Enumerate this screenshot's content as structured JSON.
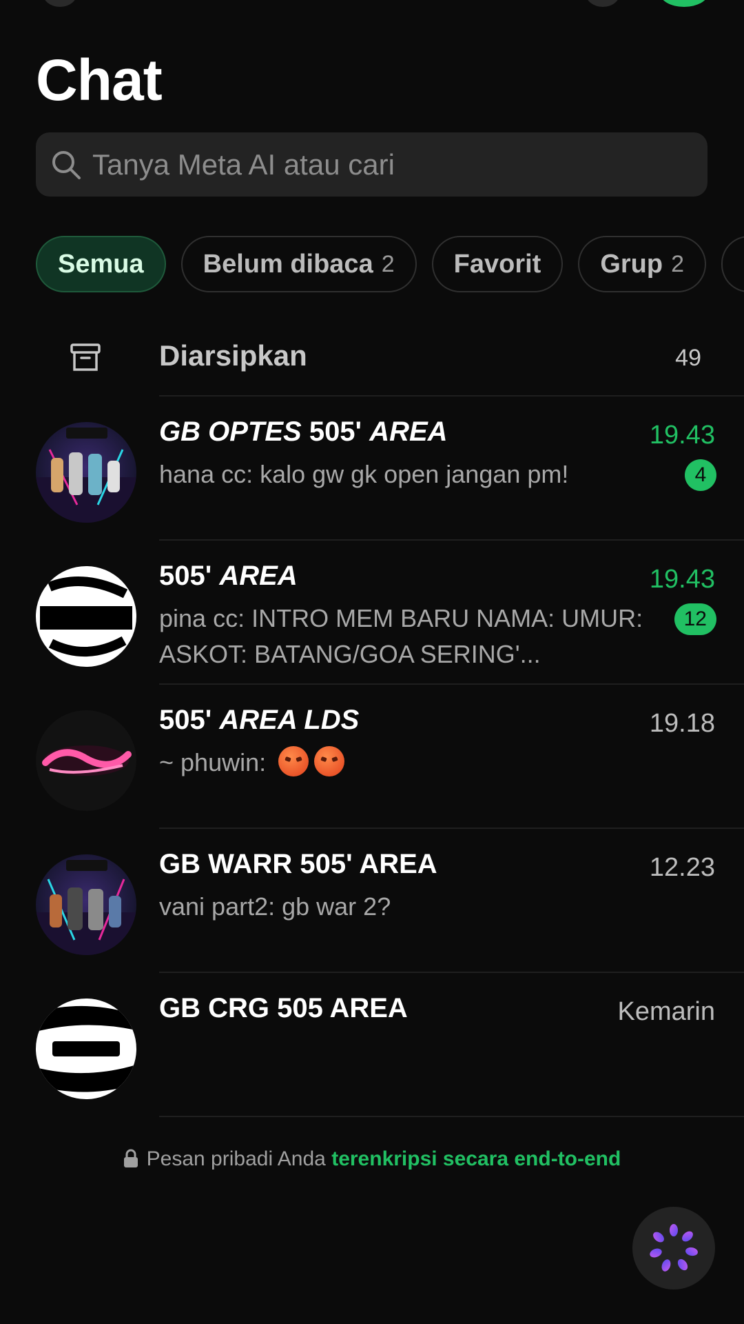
{
  "header": {
    "title": "Chat"
  },
  "search": {
    "placeholder": "Tanya Meta AI atau cari"
  },
  "filters": [
    {
      "label": "Semua",
      "count": "",
      "active": true
    },
    {
      "label": "Belum dibaca",
      "count": "2",
      "active": false
    },
    {
      "label": "Favorit",
      "count": "",
      "active": false
    },
    {
      "label": "Grup",
      "count": "2",
      "active": false
    }
  ],
  "archived": {
    "label": "Diarsipkan",
    "count": "49"
  },
  "chats": [
    {
      "name_italic": "GB OPTES",
      "name_normal": " 505' ",
      "name_italic2": "AREA",
      "time": "19.43",
      "sender": "hana cc",
      "message": ": kalo gw gk open jangan pm!",
      "unread": "4"
    },
    {
      "name_normal": "505' ",
      "name_italic": "AREA",
      "time": "19.43",
      "sender": "pina cc",
      "message": ": INTRO MEM BARU NAMA: UMUR: ASKOT: BATANG/GOA SERING'...",
      "unread": "12"
    },
    {
      "name_normal": "505' ",
      "name_italic": "AREA LDS",
      "time": "19.18",
      "sender": "~ phuwin",
      "message": ": "
    },
    {
      "name": "GB WARR 505' AREA",
      "time": "12.23",
      "sender": "vani part2",
      "message": ": gb war 2?"
    },
    {
      "name": "GB CRG 505 AREA",
      "time": "Kemarin"
    }
  ],
  "footer": {
    "text": "Pesan pribadi Anda ",
    "link": "terenkripsi secara end-to-end"
  },
  "colors": {
    "accent": "#21c063",
    "background": "#0b0b0b",
    "surface": "#232323"
  }
}
